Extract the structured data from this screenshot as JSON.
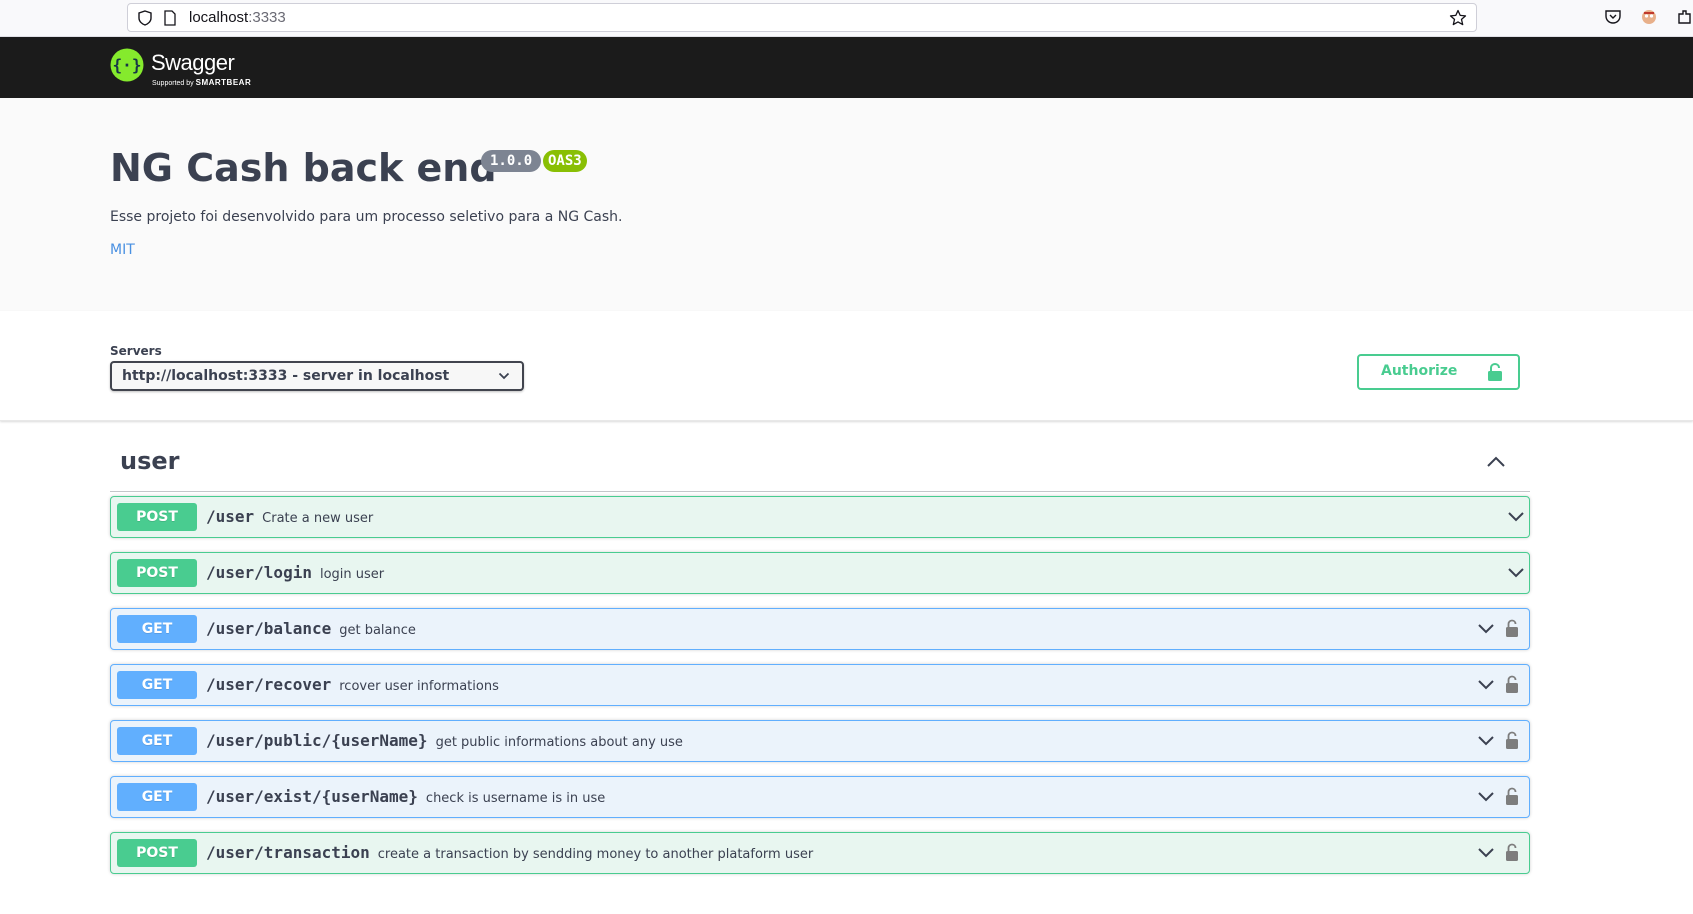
{
  "browser": {
    "url_host": "localhost",
    "url_port": ":3333"
  },
  "topbar": {
    "logo_text": "Swagger",
    "logo_sub_prefix": "Supported by",
    "logo_sub_brand": "SMARTBEAR",
    "logo_color": "#85ea2d"
  },
  "info": {
    "title": "NG Cash back end",
    "version": "1.0.0",
    "oas": "OAS3",
    "description": "Esse projeto foi desenvolvido para um processo seletivo para a NG Cash.",
    "license": "MIT"
  },
  "servers": {
    "label": "Servers",
    "selected": "http://localhost:3333 - server in localhost"
  },
  "authorize": {
    "label": "Authorize",
    "color": "#49cc90"
  },
  "tag": {
    "name": "user"
  },
  "operations": [
    {
      "method": "POST",
      "path": "/user",
      "summary": "Crate a new user",
      "locked": false
    },
    {
      "method": "POST",
      "path": "/user/login",
      "summary": "login user",
      "locked": false
    },
    {
      "method": "GET",
      "path": "/user/balance",
      "summary": "get balance",
      "locked": true
    },
    {
      "method": "GET",
      "path": "/user/recover",
      "summary": "rcover user informations",
      "locked": true
    },
    {
      "method": "GET",
      "path": "/user/public/{userName}",
      "summary": "get public informations about any use",
      "locked": true
    },
    {
      "method": "GET",
      "path": "/user/exist/{userName}",
      "summary": "check is username is in use",
      "locked": true
    },
    {
      "method": "POST",
      "path": "/user/transaction",
      "summary": "create a transaction by sendding money to another plataform user",
      "locked": true
    }
  ]
}
